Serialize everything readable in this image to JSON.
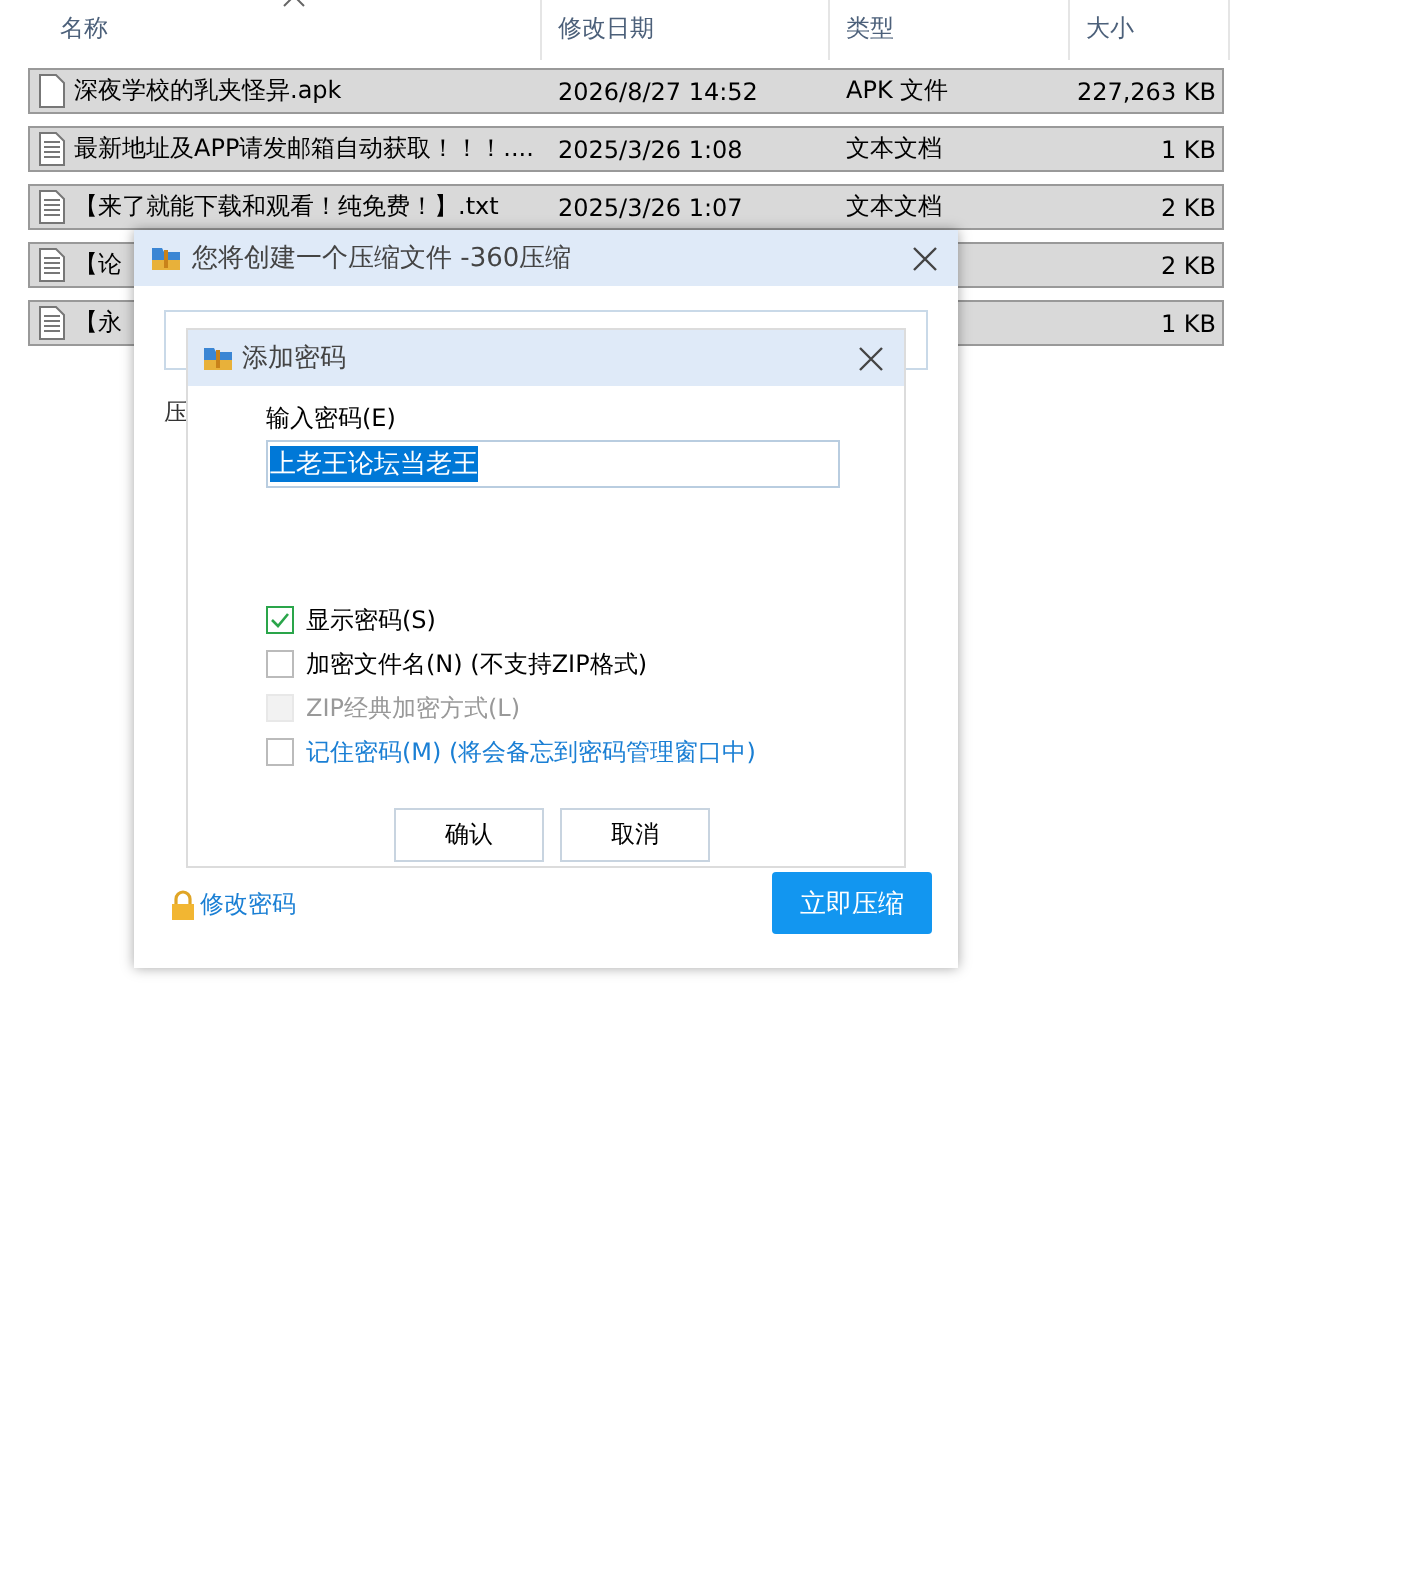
{
  "explorer": {
    "columns": [
      "名称",
      "修改日期",
      "类型",
      "大小"
    ],
    "rows": [
      {
        "kind": "blank",
        "name": "深夜学校的乳夹怪异.apk",
        "date": "2026/8/27 14:52",
        "type": "APK 文件",
        "size": "227,263 KB",
        "selected": true
      },
      {
        "kind": "text",
        "name": "最新地址及APP请发邮箱自动获取！！！....",
        "date": "2025/3/26 1:08",
        "type": "文本文档",
        "size": "1 KB",
        "selected": true
      },
      {
        "kind": "text",
        "name": "【来了就能下载和观看！纯免费！】.txt",
        "date": "2025/3/26 1:07",
        "type": "文本文档",
        "size": "2 KB",
        "selected": true
      },
      {
        "kind": "text",
        "name": "【论",
        "size": "2 KB",
        "selected": true
      },
      {
        "kind": "text",
        "name": "【永",
        "size": "1 KB",
        "selected": true
      }
    ]
  },
  "compress_dialog": {
    "title": "您将创建一个压缩文件 -360压缩",
    "label": "压",
    "change_password_link": "修改密码",
    "compress_button": "立即压缩"
  },
  "password_dialog": {
    "title": "添加密码",
    "password_label": "输入密码(E)",
    "password_value": "上老王论坛当老王",
    "options": [
      {
        "kind": "plain",
        "label": "显示密码(S)",
        "checked": true,
        "disabled": false
      },
      {
        "kind": "plain",
        "label": "加密文件名(N) (不支持ZIP格式)",
        "checked": false,
        "disabled": false
      },
      {
        "kind": "plain",
        "label": "ZIP经典加密方式(L)",
        "checked": false,
        "disabled": true
      },
      {
        "kind": "link",
        "label": "记住密码(M) (将会备忘到密码管理窗口中)",
        "checked": false,
        "disabled": false
      }
    ],
    "buttons": [
      "确认",
      "取消"
    ]
  }
}
